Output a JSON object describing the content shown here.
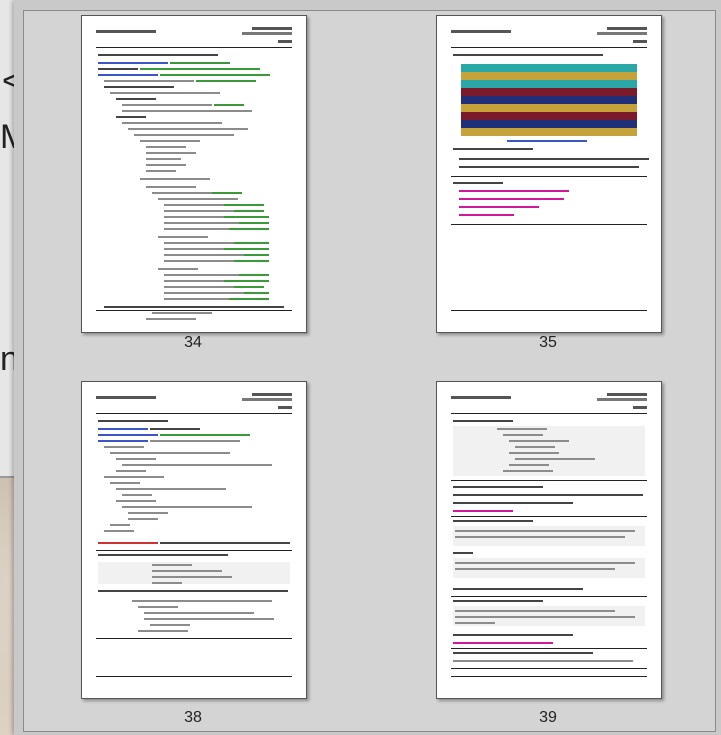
{
  "background_slide": {
    "fragment_1": "<",
    "fragment_2": "M",
    "fragment_3": "na"
  },
  "pages": [
    {
      "number": "34"
    },
    {
      "number": "35"
    },
    {
      "number": "38"
    },
    {
      "number": "39"
    }
  ],
  "colors": {
    "code_green": "#3a9a3a",
    "code_blue": "#3b56c7",
    "code_magenta": "#d0189c",
    "code_red": "#cc3333",
    "table_teal": "#2aa8a8",
    "table_gold": "#c6a23a",
    "table_navy": "#1f2f78",
    "table_maroon": "#7a1a2a"
  }
}
